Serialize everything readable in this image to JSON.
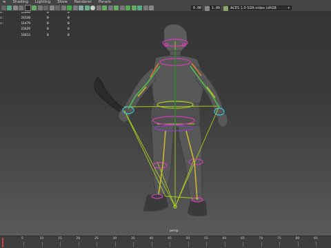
{
  "menu": {
    "items": [
      "Shading",
      "Lighting",
      "Show",
      "Renderer",
      "Panels"
    ],
    "first_partial": "w"
  },
  "toolbar": {
    "exposure_value": "0.00",
    "gamma_value": "1.00",
    "color_management": "ACES 1.0 SDR-video (sRGB"
  },
  "hud": {
    "rows": [
      {
        "label": "s:",
        "c1": "12649",
        "c2": "0",
        "c3": "0"
      },
      {
        "label": "s:",
        "c1": "24320",
        "c2": "0",
        "c3": "0"
      },
      {
        "label": "s:",
        "c1": "11479",
        "c2": "0",
        "c3": "0"
      },
      {
        "label": "",
        "c1": "23429",
        "c2": "0",
        "c3": "0"
      },
      {
        "label": "",
        "c1": "14613",
        "c2": "0",
        "c3": "0"
      }
    ]
  },
  "viewport": {
    "camera_label": "persp"
  },
  "timeline": {
    "labels": [
      "5",
      "10",
      "15",
      "20",
      "25",
      "30",
      "35",
      "40",
      "45",
      "50",
      "55",
      "60",
      "65",
      "70",
      "75",
      "80",
      "85"
    ]
  },
  "colors": {
    "joint_green": "#a8d020",
    "joint_pink": "#d040b0",
    "character": "#585858"
  }
}
